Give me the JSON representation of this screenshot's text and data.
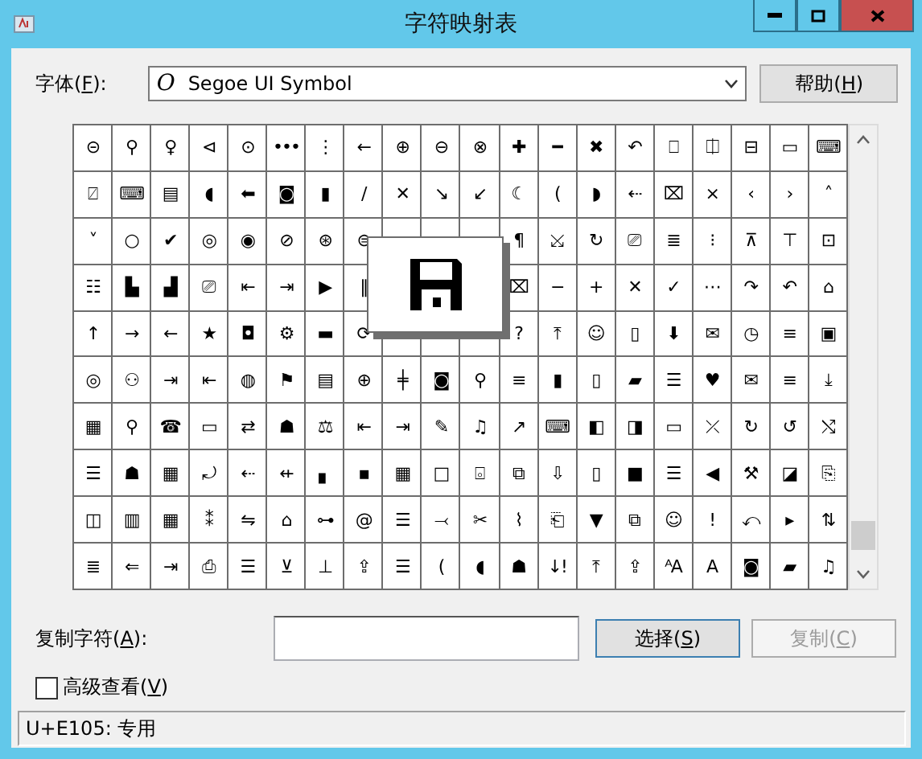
{
  "window": {
    "title": "字符映射表"
  },
  "font": {
    "label": {
      "before": "字体(",
      "key": "F",
      "after": "):"
    },
    "value": "Segoe UI Symbol",
    "glyph": "O"
  },
  "help_button": {
    "before": "帮助(",
    "key": "H",
    "after": ")"
  },
  "grid": {
    "rows": [
      [
        "⊝",
        "⚲",
        "♀",
        "⊲",
        "⊙",
        "•••",
        "⋮",
        "←",
        "⊕",
        "⊖",
        "⊗",
        "✚",
        "━",
        "✖",
        "↶",
        "⎕",
        "⎅",
        "⊟",
        "▭",
        "⌨"
      ],
      [
        "⍁",
        "⌨",
        "▤",
        "◖",
        "⬅",
        "◙",
        "▮",
        "∕",
        "✕",
        "↘",
        "↙",
        "☾",
        "(",
        "◗",
        "⇠",
        "⌧",
        "×",
        "‹",
        "›",
        "˄"
      ],
      [
        "˅",
        "○",
        "✔",
        "◎",
        "◉",
        "⊘",
        "⊛",
        "⊜",
        null,
        null,
        null,
        "¶",
        "⤩",
        "↻",
        "⎚",
        "≣",
        "⁝",
        "⊼",
        "⊤",
        "⊡"
      ],
      [
        "☷",
        "▙",
        "▟",
        "⎚",
        "⇤",
        "⇥",
        "▶",
        "‖",
        null,
        null,
        null,
        "⌧",
        "−",
        "+",
        "✕",
        "✓",
        "⋯",
        "↷",
        "↶",
        "⌂"
      ],
      [
        "↑",
        "→",
        "←",
        "★",
        "◘",
        "⚙",
        "▬",
        "⟳",
        null,
        null,
        null,
        "?",
        "⤒",
        "☺",
        "▯",
        "⬇",
        "✉",
        "◷",
        "≡",
        "▣"
      ],
      [
        "◎",
        "⚇",
        "⇥",
        "⇤",
        "◍",
        "⚑",
        "▤",
        "⊕",
        "╪",
        "◙",
        "⚲",
        "≡",
        "▮",
        "▯",
        "▰",
        "☰",
        "♥",
        "✉",
        "≡",
        "⤓"
      ],
      [
        "▦",
        "⚲",
        "☎",
        "▭",
        "⇄",
        "☗",
        "⚖",
        "⇤",
        "⇥",
        "✎",
        "♫",
        "↗",
        "⌨",
        "◧",
        "◨",
        "▭",
        "⤫",
        "↻",
        "↺",
        "⤭"
      ],
      [
        "☰",
        "☗",
        "▦",
        "⤾",
        "⇠",
        "⇷",
        "▖",
        "▪",
        "▦",
        "□",
        "⌻",
        "⧉",
        "⇩",
        "▯",
        "■",
        "☰",
        "◀",
        "⚒",
        "◪",
        "⎘"
      ],
      [
        "◫",
        "▥",
        "▦",
        "⁑",
        "⇋",
        "⌂",
        "⊶",
        "@",
        "☰",
        "⤙",
        "✂",
        "⌇",
        "⎗",
        "▼",
        "⧉",
        "☺",
        "!",
        "⤺",
        "▸",
        "⇅"
      ],
      [
        "≣",
        "⇐",
        "⇥",
        "⎙",
        "☰",
        "⊻",
        "⊥",
        "⇪",
        "☰",
        "(",
        "◖",
        "☗",
        "↓!",
        "⤒",
        "⇪",
        "ᴬA",
        "A",
        "◙",
        "▰",
        "♫"
      ]
    ]
  },
  "copy": {
    "label": {
      "before": "复制字符(",
      "key": "A",
      "after": "):"
    },
    "buttons": [
      {
        "before": "选择(",
        "key": "S",
        "after": ")",
        "disabled": false,
        "focused": true
      },
      {
        "before": "复制(",
        "key": "C",
        "after": ")",
        "disabled": true,
        "focused": false
      }
    ]
  },
  "advanced": {
    "before": "高级查看(",
    "key": "V",
    "after": ")",
    "checked": false
  },
  "status_bar": {
    "text": "U+E105: 专用"
  }
}
